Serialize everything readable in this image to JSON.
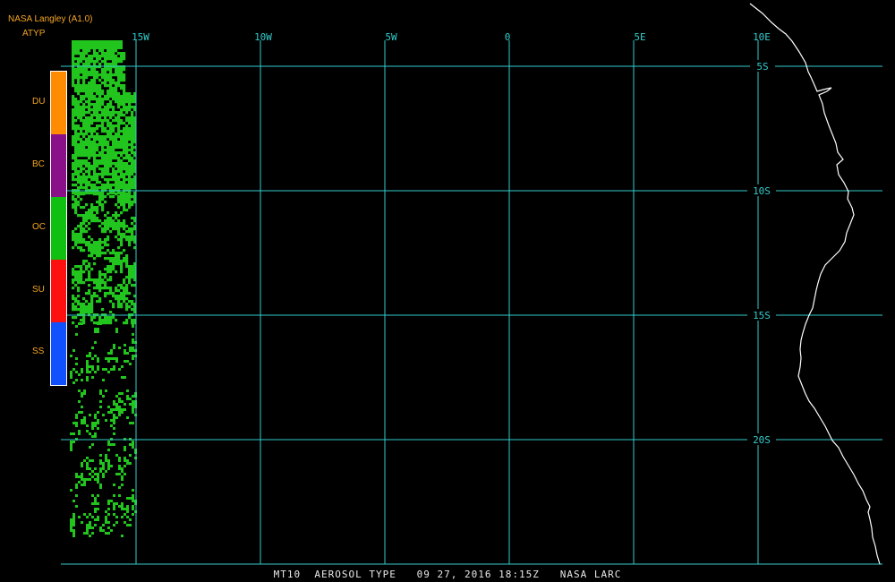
{
  "header": {
    "producer": "NASA Langley (A1.0)",
    "product_code": "ATYP"
  },
  "map": {
    "longitude_labels": [
      "15W",
      "10W",
      "5W",
      "0",
      "5E",
      "10E"
    ],
    "latitude_labels": [
      "5S",
      "10S",
      "15S",
      "20S"
    ],
    "colors": {
      "background": "#000000",
      "grid": "#33cccc",
      "coastline": "#ffffff",
      "data": "#22c41e"
    }
  },
  "legend": {
    "items": [
      {
        "code": "DU",
        "color": "#ff8c00"
      },
      {
        "code": "BC",
        "color": "#8a108a"
      },
      {
        "code": "OC",
        "color": "#10c010"
      },
      {
        "code": "SU",
        "color": "#ff1010"
      },
      {
        "code": "SS",
        "color": "#1050ff"
      }
    ]
  },
  "footer": {
    "caption": "MT10  AEROSOL TYPE   09 27, 2016 18:15Z   NASA LARC"
  }
}
